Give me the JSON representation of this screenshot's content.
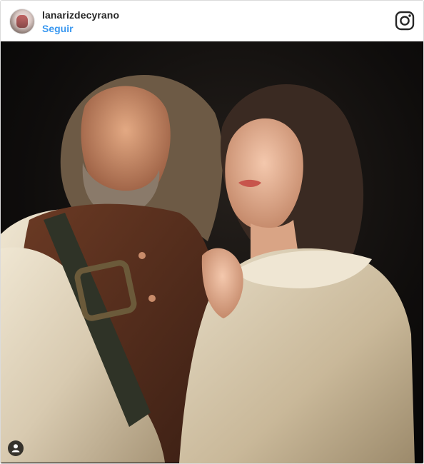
{
  "header": {
    "username": "lanarizdecyrano",
    "follow_label": "Seguir"
  },
  "icons": {
    "avatar": "profile-avatar",
    "instagram": "instagram-logo-icon",
    "tag": "user-tag-icon"
  },
  "colors": {
    "follow_blue": "#3897f0",
    "text_dark": "#262626",
    "photo_background": "#0a0908"
  }
}
